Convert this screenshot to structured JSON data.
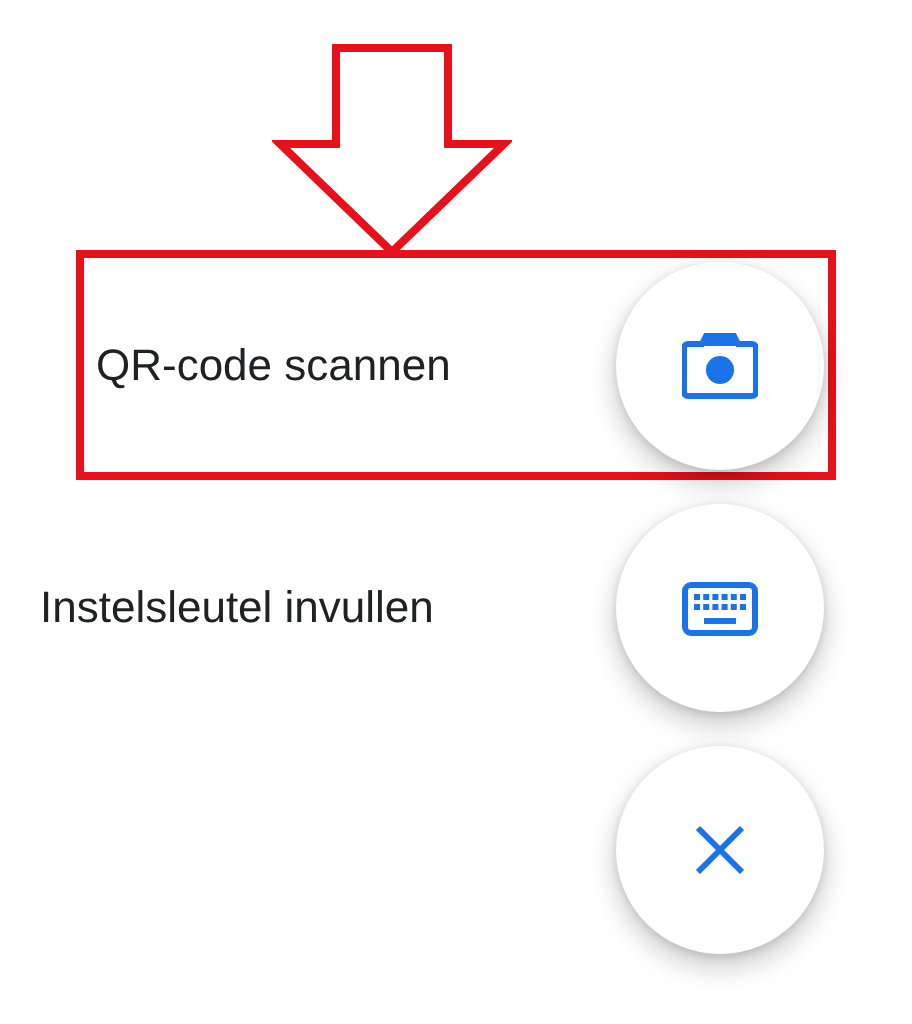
{
  "actions": [
    {
      "kind": "camera",
      "label": "QR-code scannen",
      "highlighted": true
    },
    {
      "kind": "keyboard",
      "label": "Instelsleutel invullen",
      "highlighted": false
    }
  ],
  "close_button": {
    "kind": "close"
  }
}
